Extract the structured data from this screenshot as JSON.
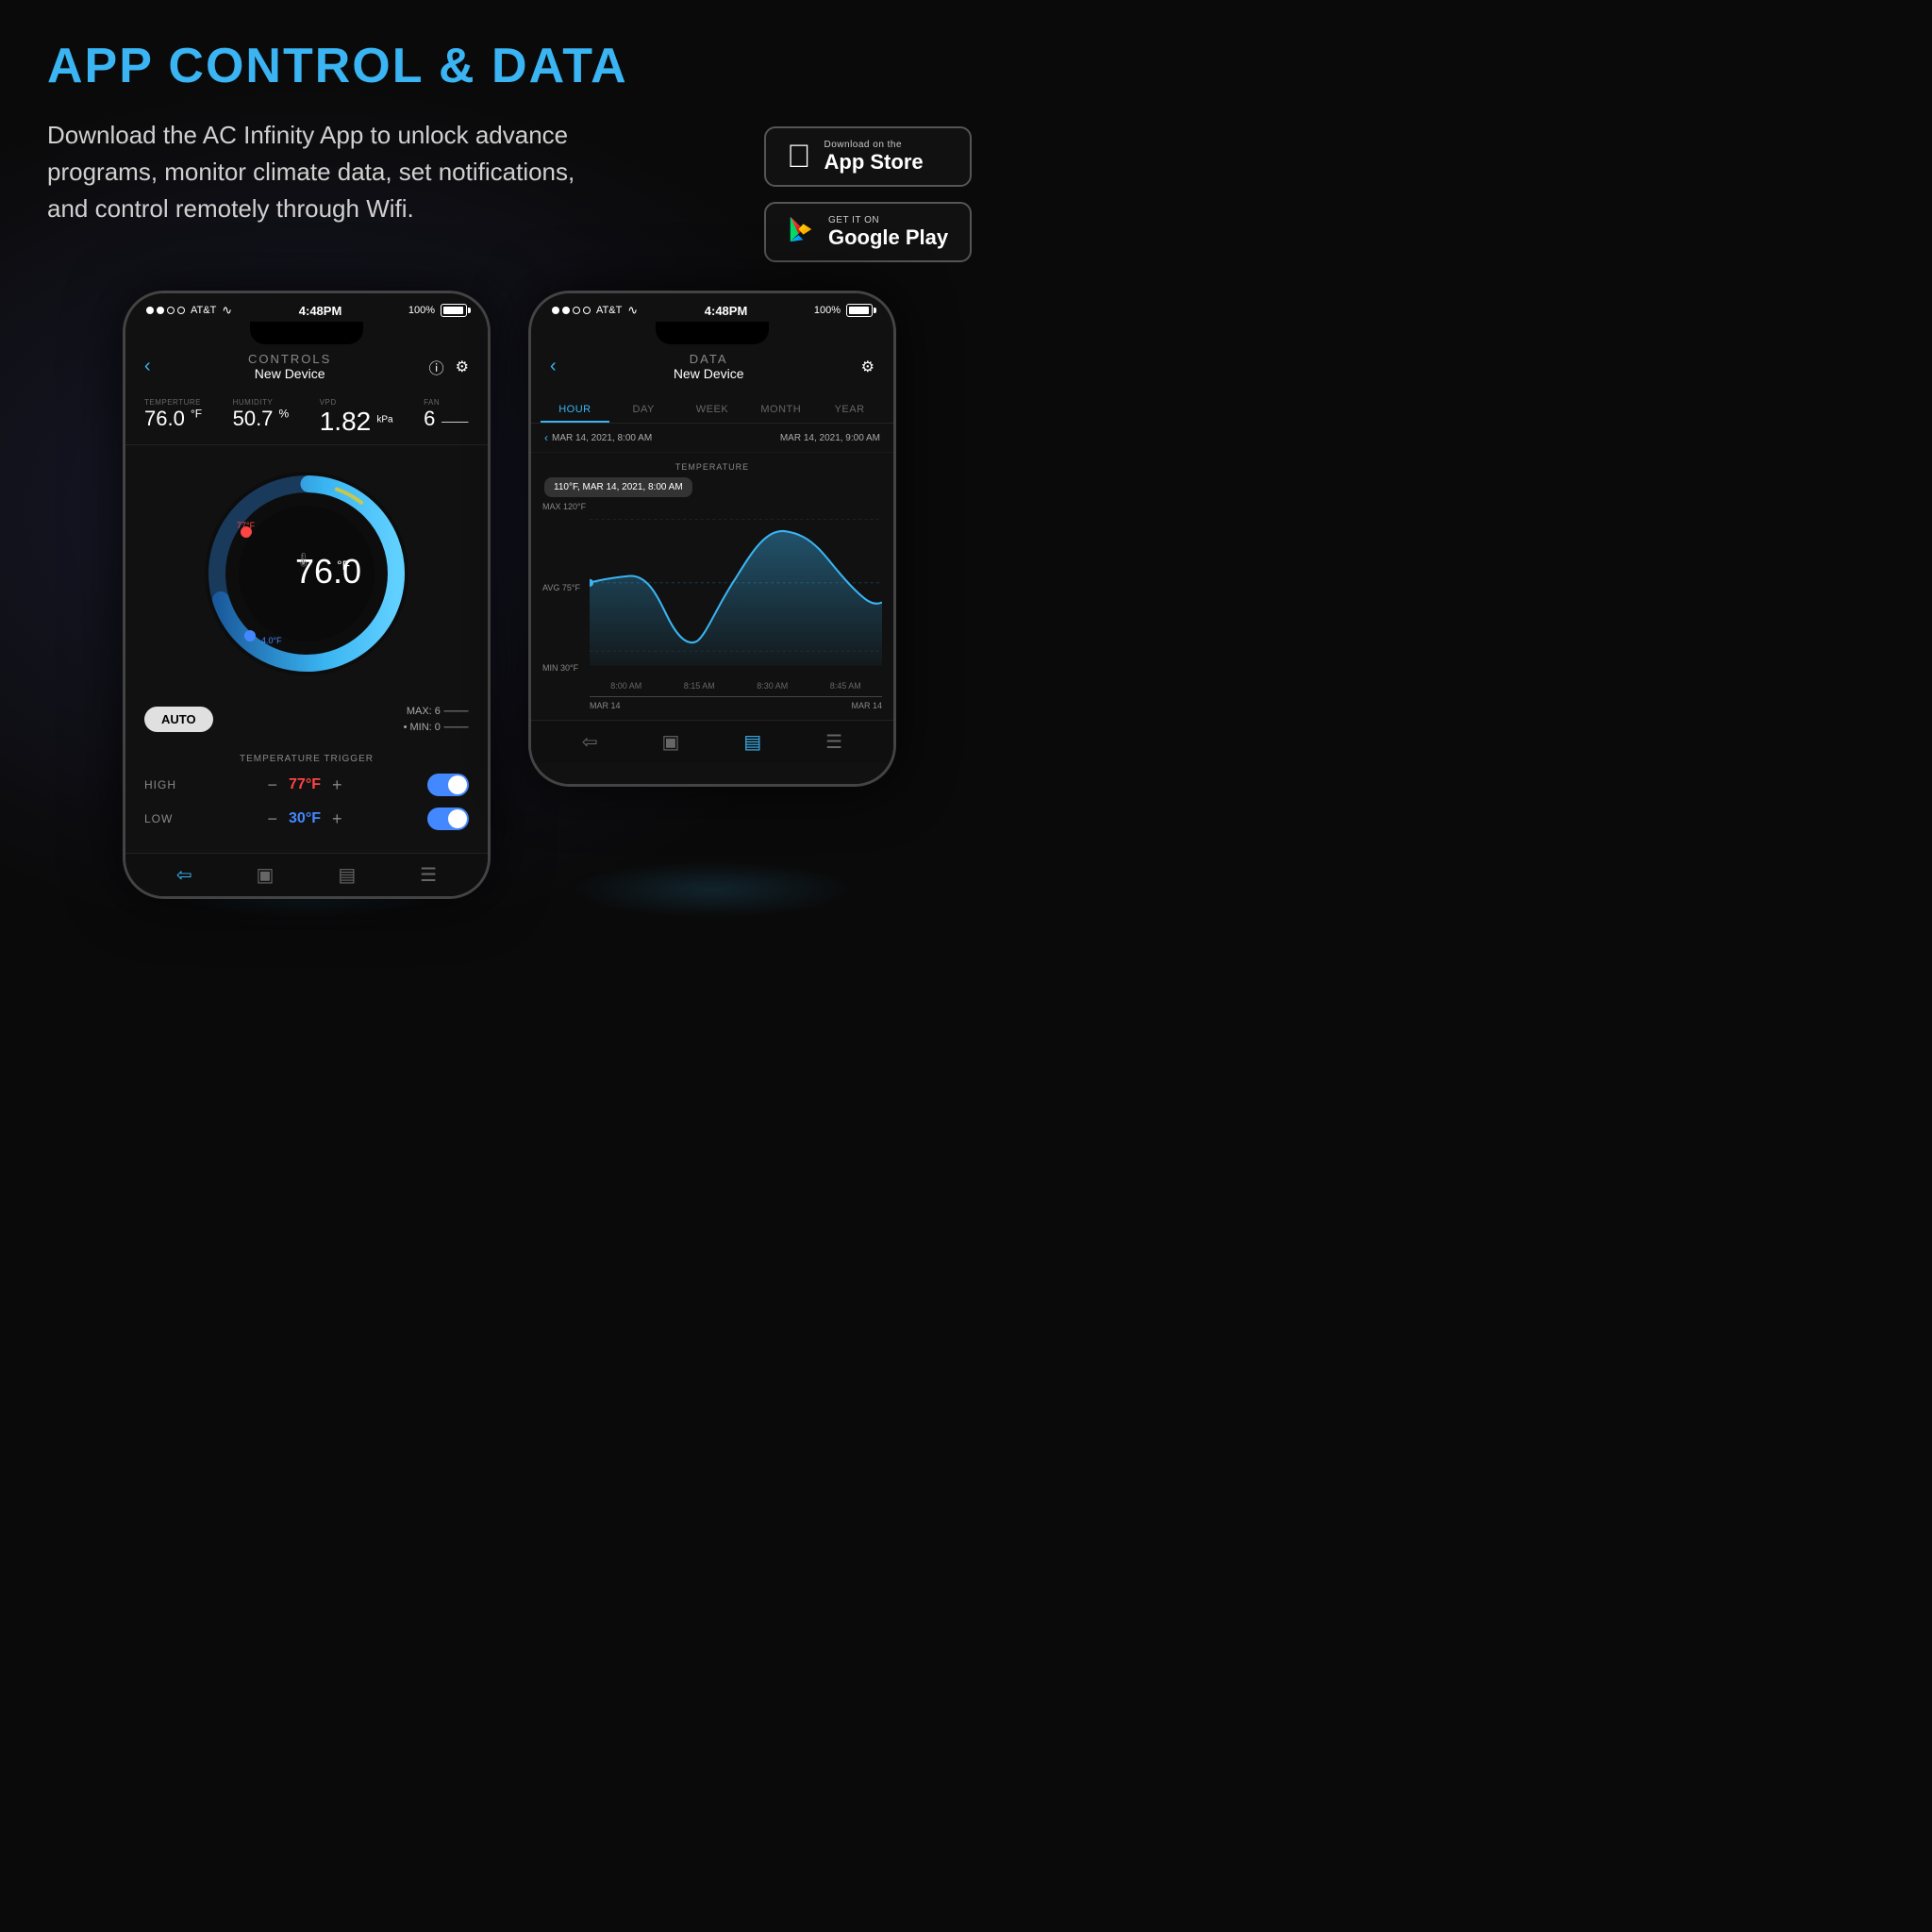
{
  "page": {
    "title": "APP CONTROL & DATA",
    "description": "Download the AC Infinity App to unlock advance programs, monitor climate data, set notifications, and control remotely through Wifi."
  },
  "app_store": {
    "label_small": "Download on the",
    "label_big": "App Store"
  },
  "google_play": {
    "label_small": "GET IT ON",
    "label_big": "Google Play"
  },
  "phone_controls": {
    "screen_title": "CONTROLS",
    "device_name": "New Device",
    "status_time": "4:48PM",
    "status_battery": "100%",
    "status_carrier": "AT&T",
    "sensors": [
      {
        "label": "TEMPERATURE",
        "value": "76.0 °F"
      },
      {
        "label": "HUMIDITY",
        "value": "50.7 %"
      },
      {
        "label": "VPD",
        "value": "1.82 kPa"
      },
      {
        "label": "FAN",
        "value": "6"
      }
    ],
    "gauge_value": "76.0°F",
    "temp_min_marker": "4.0°F",
    "temp_max_marker": "77°F",
    "auto_button": "AUTO",
    "max_label": "MAX: 6",
    "min_label": "MIN: 0",
    "trigger_title": "TEMPERATURE TRIGGER",
    "high_label": "HIGH",
    "high_value": "77°F",
    "low_label": "LOW",
    "low_value": "30°F"
  },
  "phone_data": {
    "screen_title": "DATA",
    "device_name": "New Device",
    "status_time": "4:48PM",
    "status_battery": "100%",
    "status_carrier": "AT&T",
    "tabs": [
      "HOUR",
      "DAY",
      "WEEK",
      "MONTH",
      "YEAR"
    ],
    "active_tab": "HOUR",
    "date_from": "MAR 14, 2021, 8:00 AM",
    "date_to": "MAR 14, 2021, 9:00 AM",
    "chart_title": "TEMPERATURE",
    "tooltip": "110°F, MAR 14, 2021, 8:00 AM",
    "y_labels": [
      "MAX 120°F",
      "AVG 75°F",
      "MIN 30°F"
    ],
    "x_labels": [
      "8:00 AM",
      "8:15 AM",
      "8:30 AM",
      "8:45 AM"
    ],
    "bottom_labels": [
      "MAR 14",
      "MAR 14"
    ]
  }
}
